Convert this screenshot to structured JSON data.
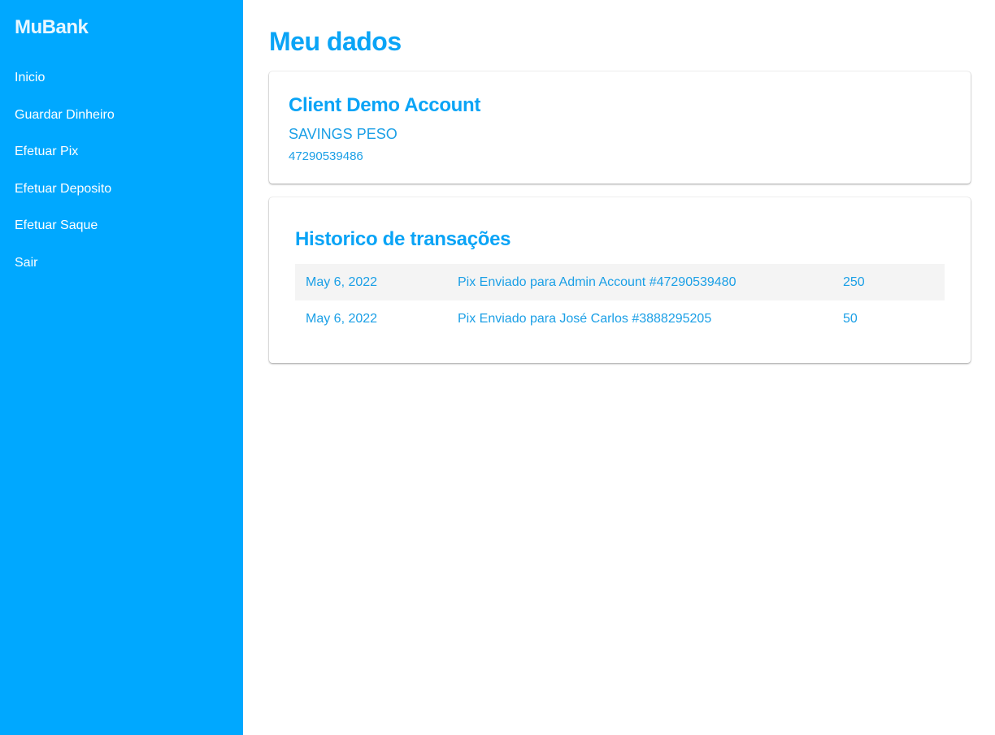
{
  "sidebar": {
    "brand": "MuBank",
    "items": [
      {
        "label": "Inicio"
      },
      {
        "label": "Guardar Dinheiro"
      },
      {
        "label": "Efetuar Pix"
      },
      {
        "label": "Efetuar Deposito"
      },
      {
        "label": "Efetuar Saque"
      },
      {
        "label": "Sair"
      }
    ]
  },
  "main": {
    "title": "Meu dados",
    "account": {
      "name": "Client Demo Account",
      "type": "SAVINGS PESO",
      "number": "47290539486"
    },
    "history": {
      "title": "Historico de transações",
      "rows": [
        {
          "date": "May 6, 2022",
          "description": "Pix Enviado para Admin Account #47290539480",
          "amount": "250"
        },
        {
          "date": "May 6, 2022",
          "description": "Pix Enviado para José Carlos #3888295205",
          "amount": "50"
        }
      ]
    }
  },
  "colors": {
    "sidebar_bg": "#00a8ff",
    "accent": "#0aa4f6",
    "text_blue": "#1a9fe6",
    "row_stripe": "#f4f4f4"
  }
}
